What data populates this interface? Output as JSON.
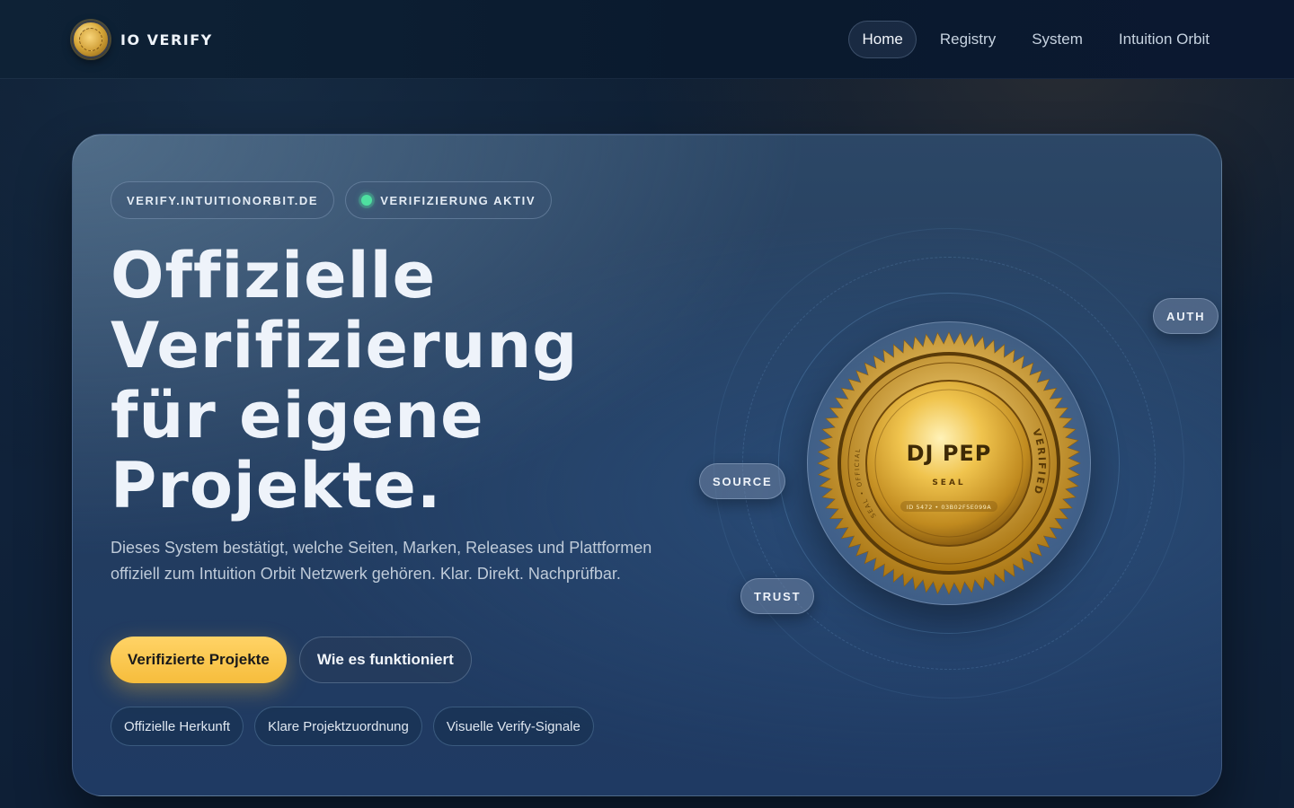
{
  "brand": {
    "name": "IO VERIFY",
    "logo_icon": "gold-seal-icon"
  },
  "nav": {
    "items": [
      {
        "label": "Home",
        "active": true
      },
      {
        "label": "Registry",
        "active": false
      },
      {
        "label": "System",
        "active": false
      },
      {
        "label": "Intuition Orbit",
        "active": false
      }
    ]
  },
  "hero": {
    "domain_pill": "VERIFY.INTUITIONORBIT.DE",
    "status_pill": "VERIFIZIERUNG AKTIV",
    "status_color": "#4ee0a0",
    "headline": [
      "Offizielle",
      "Verifizierung",
      "für eigene",
      "Projekte."
    ],
    "lead": "Dieses System bestätigt, welche Seiten, Marken, Releases und Plattformen offiziell zum Intuition Orbit Netzwerk gehören. Klar. Direkt. Nachprüfbar.",
    "primary_button": "Verifizierte Projekte",
    "secondary_button": "Wie es funktioniert",
    "tags": [
      "Offizielle Herkunft",
      "Klare Projektzuordnung",
      "Visuelle Verify-Signale"
    ]
  },
  "seal": {
    "name": "DJ PEP",
    "label": "SEAL",
    "id_text": "ID 5472 • 03B02F5E099A",
    "ring_text": "VERIFIED",
    "ring_text_left": "SEAL • OFFICIAL",
    "accent": "#f6bd3c"
  },
  "orbit_tags": {
    "auth": "AUTH",
    "source": "SOURCE",
    "trust": "TRUST"
  }
}
